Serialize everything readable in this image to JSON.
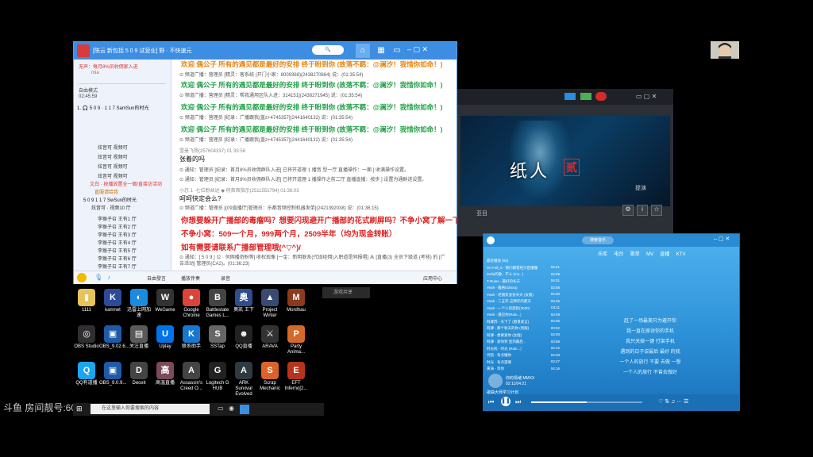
{
  "chat": {
    "title": "[陈云 新包括 5 0 9  试营业] 野 · 不快速元",
    "sidebar": {
      "top_items": [
        "无声：每月8%员收佣家入进",
        "mia"
      ],
      "mode_label": "自由模式",
      "timer": "02:45:59",
      "channel": "1. 🎧 5 0 9  · 1 1 7 SamSun的时光",
      "members": [
        "炫音可",
        "炫音可",
        "炫音可",
        "炫音可"
      ],
      "member_sub": "  视频可",
      "subchannel_a": "文白 · 按播放置全一面/直接访活动",
      "subchannel_b": "直服请给我",
      "channel2": "5 0 9  1 1 7 SwSun的时光",
      "rooms_a": [
        "炫音可 · 视频10 厅"
      ],
      "rooms_b": [
        "李猴子召",
        "李猴子召",
        "李猴子召",
        "李猴子召",
        "李猴子召",
        "李猴子召",
        "李猴子召",
        "李猴子召"
      ],
      "room_labels_b": [
        "王有1 厅",
        "王有2 厅",
        "王有3 厅",
        "王有4 厅",
        "王有5 厅",
        "王有6 厅",
        "王有7 厅",
        "王有8 厅"
      ]
    },
    "messages": {
      "welcome_line": "欢迎  偶公子  所有的遇见都是最好的安排   终于盼到你   (故落不羁：@澜汐！我惜你如命！)",
      "sys1": "⊙ 频道广播：营理员 [精灵：客系统 (开门小家：8009368)(2438270864) 说：(01:35:54)",
      "sys2": "⊙ 频道广播：营理员 [精灵：帮我通用区队入进：314151](2438271945) 说：(01:35:54)",
      "sys3": "⊙ 频道广播：营理员 [纪录：广播跟我(盖z+4745357](2441640132) 说：(01:35:54)",
      "sys4": "⊙ 频道广播：营理员 [纪录：广播跟我(盖z+4745357](2441640132) 说：(01:35:54)",
      "user_header": "雪曼飞扬(257604337) 01:35:58",
      "user_text": "张着的吗",
      "notice1": "⊙ 通知：管理员 [纪录：首月8%员收佣群队入进] 已将开道理 1 播音 型一厅 直播操作：一面 ] 收满操作设置。",
      "notice2": "⊙ 通知：管理员 [纪录：首月8%员收佣群队入进] 已将开道理 1 播操作之前二厅 直播直播：按步 ] 设置为通群进设置。",
      "user2_header": "小忍 1 -七位粉丝达 ◆ 何首席指示(2511551794) 01:36:03",
      "user2_text": "呵呵快定会么?",
      "sys5": "⊙ 频道广播：管理员 [(09直播厅)管理员：乐都音频控制机器发单](2421392038) 说：(01:36:15)",
      "red1": "你想要躲开广播部的毒瘤吗？想要闪现避开广播部的花式刷屏吗？不争小窝了解一下",
      "red2": "不争小窝：509一个月，999两个月，2509半年（均为现金转账）",
      "red3": "如有需要请联系广播部管理哦(^▽^)/",
      "notice3": "⊙ 通知：[ 5 0 9  ] 公 · 何网播奇盼等] 收权现像 [一金：新明联系(代现经佣)入职道是同报唱] 从 [直播(3) 全员下级道 (考核) 的 [广告活动] 管理员(CA2)。(01:36:23)"
    },
    "bottombar": {
      "free_mode": "自由發言",
      "accompany": "播放伴奏",
      "record": "录音",
      "app_center": "应用中心"
    }
  },
  "desktop": {
    "icons": [
      {
        "label": "1111",
        "color": "#e8c25b",
        "glyph": "▮"
      },
      {
        "label": "kamnet",
        "color": "#2b4a9a",
        "glyph": "K"
      },
      {
        "label": "迅雷上网加速",
        "color": "#1a8ce0",
        "glyph": "◐"
      },
      {
        "label": "WeGame",
        "color": "#333",
        "glyph": "W"
      },
      {
        "label": "Google Chrome",
        "color": "#db4437",
        "glyph": "●"
      },
      {
        "label": "Battlestate Games L...",
        "color": "#444",
        "glyph": "B"
      },
      {
        "label": "奥凯 王下",
        "color": "#2d4d8f",
        "glyph": "奥"
      },
      {
        "label": "Project Winter",
        "color": "#3b4a72",
        "glyph": "▲"
      },
      {
        "label": "Mordhau",
        "color": "#8a3b1c",
        "glyph": "M"
      },
      {
        "label": "OBS Studio",
        "color": "#302e31",
        "glyph": "◎"
      },
      {
        "label": "OBS_9.02.6...",
        "color": "#1e5aa8",
        "glyph": "▣"
      },
      {
        "label": "关注直播",
        "color": "#5a5a5a",
        "glyph": "▤"
      },
      {
        "label": "Uplay",
        "color": "#0073e6",
        "glyph": "U"
      },
      {
        "label": "联系助手",
        "color": "#1877d1",
        "glyph": "K"
      },
      {
        "label": "SSTap",
        "color": "#666",
        "glyph": "S"
      },
      {
        "label": "QQ直播",
        "color": "#222",
        "glyph": "☻"
      },
      {
        "label": "ARAVA",
        "color": "#333",
        "glyph": "⚔"
      },
      {
        "label": "Party Anima...",
        "color": "#d46a2a",
        "glyph": "P"
      },
      {
        "label": "QQ有道播",
        "color": "#1aa6f0",
        "glyph": "Q"
      },
      {
        "label": "OBS_9.0.9...",
        "color": "#1e5aa8",
        "glyph": "▣"
      },
      {
        "label": "Deceit",
        "color": "#444",
        "glyph": "D"
      },
      {
        "label": "高温直播",
        "color": "#7a4a5a",
        "glyph": "高"
      },
      {
        "label": "Assassin's Creed O...",
        "color": "#444",
        "glyph": "A"
      },
      {
        "label": "Logitech G HUB",
        "color": "#222",
        "glyph": "G"
      },
      {
        "label": "ARK Survival Evolved",
        "color": "#2f3a40",
        "glyph": "A"
      },
      {
        "label": "Scrap Mechanic",
        "color": "#d9632b",
        "glyph": "S"
      },
      {
        "label": "EFT Inferno[2...",
        "color": "#b5341b",
        "glyph": "E"
      }
    ]
  },
  "video": {
    "title_text": "纸人",
    "title_badge": "贰",
    "caption": "提演",
    "sub": "亚目"
  },
  "music": {
    "tabs": [
      "乐库",
      "电台",
      "歌单",
      "MV",
      "直播",
      "KTV"
    ],
    "search_placeholder": "搜索音乐",
    "list": [
      "最近播放  (89)",
      "On Fall_5 - 我们都曾经只是懵懂",
      "Sofia的歌 - 不十 (Ins...)",
      "T-Rules - 最好的冬天",
      "Yeah - 雅格(Glissa)",
      "Yeah - 老朋友会会天天 (女版)",
      "Yeah - 二五年 这两年的夏天",
      "Yeah - 一个人的旅程(2020)",
      "Yeah - 遇见你(Rain...)",
      "阿肆苏 - 天下了 (愿景发言)",
      "阿肆 - 那个秋天的你 (男版)",
      "阿肆 - 想要爱你 (女版)",
      "阿肆 - 爱你到 直到最后 ..",
      "时光机 - 时光 (Rain...)",
      "鸿鹄 - 有点懂你",
      "时光 - 有点遗憾",
      "黄海 - 等你"
    ],
    "durations": [
      "04:21",
      "04:09",
      "04:01",
      "03:58",
      "04:00",
      "03:45",
      "04:11",
      "03:49",
      "04:05",
      "03:52",
      "04:00",
      "03:58",
      "04:12",
      "04:03",
      "03:47",
      "04:16",
      "04:04"
    ],
    "lyrics": [
      "赶了一场最美只为避开你",
      "我一直在原谅你的手机",
      "我只关掉一键 打架手机",
      "遇到的日子说最后 最好 的我",
      "一个人的旅行 不要 去做 一想",
      "一个人的旅行 不曾去做好"
    ],
    "now_playing": "你的情绪  MMXX",
    "now_time": "02:11/04:21",
    "footer_label": "歌曲大师学习计划"
  },
  "taskbar": {
    "search_placeholder": "在这里输入你要搜索的内容"
  },
  "watermark": "斗鱼 房间靓号:60066",
  "minor_label": "游戏共享"
}
